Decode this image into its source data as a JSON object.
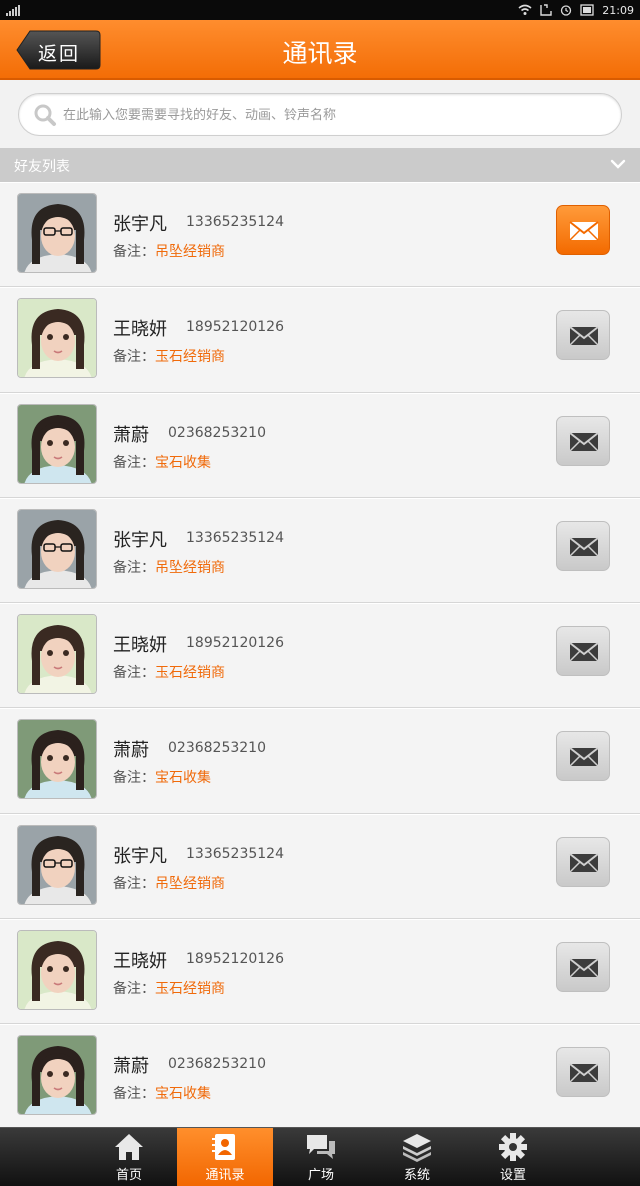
{
  "status_bar": {
    "time": "21:09"
  },
  "header": {
    "back_label": "返回",
    "title": "通讯录"
  },
  "search": {
    "placeholder": "在此输入您要需要寻找的好友、动画、铃声名称"
  },
  "section": {
    "title": "好友列表"
  },
  "note_label": "备注：",
  "contacts": [
    {
      "name": "张宇凡",
      "phone": "13365235124",
      "note": "吊坠经销商",
      "avatar": "boy",
      "unread": true
    },
    {
      "name": "王晓妍",
      "phone": "18952120126",
      "note": "玉石经销商",
      "avatar": "girl1",
      "unread": false
    },
    {
      "name": "萧蔚",
      "phone": "02368253210",
      "note": "宝石收集",
      "avatar": "girl2",
      "unread": false
    },
    {
      "name": "张宇凡",
      "phone": "13365235124",
      "note": "吊坠经销商",
      "avatar": "boy",
      "unread": false
    },
    {
      "name": "王晓妍",
      "phone": "18952120126",
      "note": "玉石经销商",
      "avatar": "girl1",
      "unread": false
    },
    {
      "name": "萧蔚",
      "phone": "02368253210",
      "note": "宝石收集",
      "avatar": "girl2",
      "unread": false
    },
    {
      "name": "张宇凡",
      "phone": "13365235124",
      "note": "吊坠经销商",
      "avatar": "boy",
      "unread": false
    },
    {
      "name": "王晓妍",
      "phone": "18952120126",
      "note": "玉石经销商",
      "avatar": "girl1",
      "unread": false
    },
    {
      "name": "萧蔚",
      "phone": "02368253210",
      "note": "宝石收集",
      "avatar": "girl2",
      "unread": false
    }
  ],
  "tabbar": {
    "items": [
      {
        "label": "首页",
        "icon": "home-icon",
        "active": false
      },
      {
        "label": "通讯录",
        "icon": "contacts-icon",
        "active": true
      },
      {
        "label": "广场",
        "icon": "chat-bubbles-icon",
        "active": false
      },
      {
        "label": "系统",
        "icon": "layers-icon",
        "active": false
      },
      {
        "label": "设置",
        "icon": "gear-icon",
        "active": false
      }
    ]
  },
  "colors": {
    "accent": "#f36d06",
    "note_value": "#f06a0a",
    "section_bar": "#cbcbcb"
  }
}
